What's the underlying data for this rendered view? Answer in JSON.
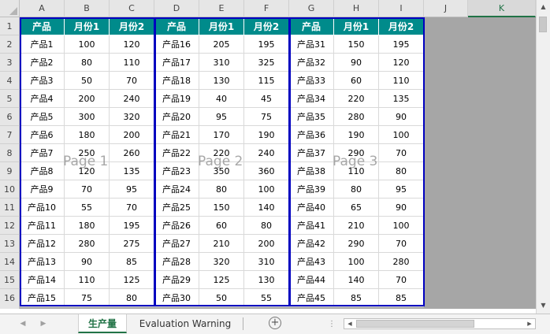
{
  "columns": [
    "A",
    "B",
    "C",
    "D",
    "E",
    "F",
    "G",
    "H",
    "I",
    "J",
    "K"
  ],
  "selected_column": "K",
  "rows": [
    "1",
    "2",
    "3",
    "4",
    "5",
    "6",
    "7",
    "8",
    "9",
    "10",
    "11",
    "12",
    "13",
    "14",
    "15",
    "16"
  ],
  "header_row": [
    "产品",
    "月份1",
    "月份2",
    "产品",
    "月份1",
    "月份2",
    "产品",
    "月份1",
    "月份2"
  ],
  "data": [
    [
      "产品1",
      "100",
      "120",
      "产品16",
      "205",
      "195",
      "产品31",
      "150",
      "195"
    ],
    [
      "产品2",
      "80",
      "110",
      "产品17",
      "310",
      "325",
      "产品32",
      "90",
      "120"
    ],
    [
      "产品3",
      "50",
      "70",
      "产品18",
      "130",
      "115",
      "产品33",
      "60",
      "110"
    ],
    [
      "产品4",
      "200",
      "240",
      "产品19",
      "40",
      "45",
      "产品34",
      "220",
      "135"
    ],
    [
      "产品5",
      "300",
      "320",
      "产品20",
      "95",
      "75",
      "产品35",
      "280",
      "90"
    ],
    [
      "产品6",
      "180",
      "200",
      "产品21",
      "170",
      "190",
      "产品36",
      "190",
      "100"
    ],
    [
      "产品7",
      "250",
      "260",
      "产品22",
      "220",
      "240",
      "产品37",
      "290",
      "70"
    ],
    [
      "产品8",
      "120",
      "135",
      "产品23",
      "350",
      "360",
      "产品38",
      "110",
      "80"
    ],
    [
      "产品9",
      "70",
      "95",
      "产品24",
      "80",
      "100",
      "产品39",
      "80",
      "95"
    ],
    [
      "产品10",
      "55",
      "70",
      "产品25",
      "150",
      "140",
      "产品40",
      "65",
      "90"
    ],
    [
      "产品11",
      "180",
      "195",
      "产品26",
      "60",
      "80",
      "产品41",
      "210",
      "100"
    ],
    [
      "产品12",
      "280",
      "275",
      "产品27",
      "210",
      "200",
      "产品42",
      "290",
      "70"
    ],
    [
      "产品13",
      "90",
      "85",
      "产品28",
      "320",
      "310",
      "产品43",
      "100",
      "280"
    ],
    [
      "产品14",
      "110",
      "125",
      "产品29",
      "125",
      "130",
      "产品44",
      "140",
      "70"
    ],
    [
      "产品15",
      "75",
      "80",
      "产品30",
      "50",
      "55",
      "产品45",
      "85",
      "85"
    ]
  ],
  "page_labels": [
    "Page 1",
    "Page 2",
    "Page 3"
  ],
  "sheet_tabs": {
    "active": "生产量",
    "other": "Evaluation Warning",
    "add_label": "+"
  },
  "icons": {
    "tab_nav_prev": "chevron-left-icon",
    "tab_nav_next": "chevron-right-icon",
    "add_sheet": "plus-circle-icon",
    "scroll_up": "caret-up-icon",
    "scroll_down": "caret-down-icon",
    "scroll_left": "caret-left-icon",
    "scroll_right": "caret-right-icon"
  },
  "colors": {
    "header_fill": "#008b8b",
    "page_border": "#0000c0",
    "sheet_background": "#a6a6a6",
    "active_tab": "#217346"
  }
}
